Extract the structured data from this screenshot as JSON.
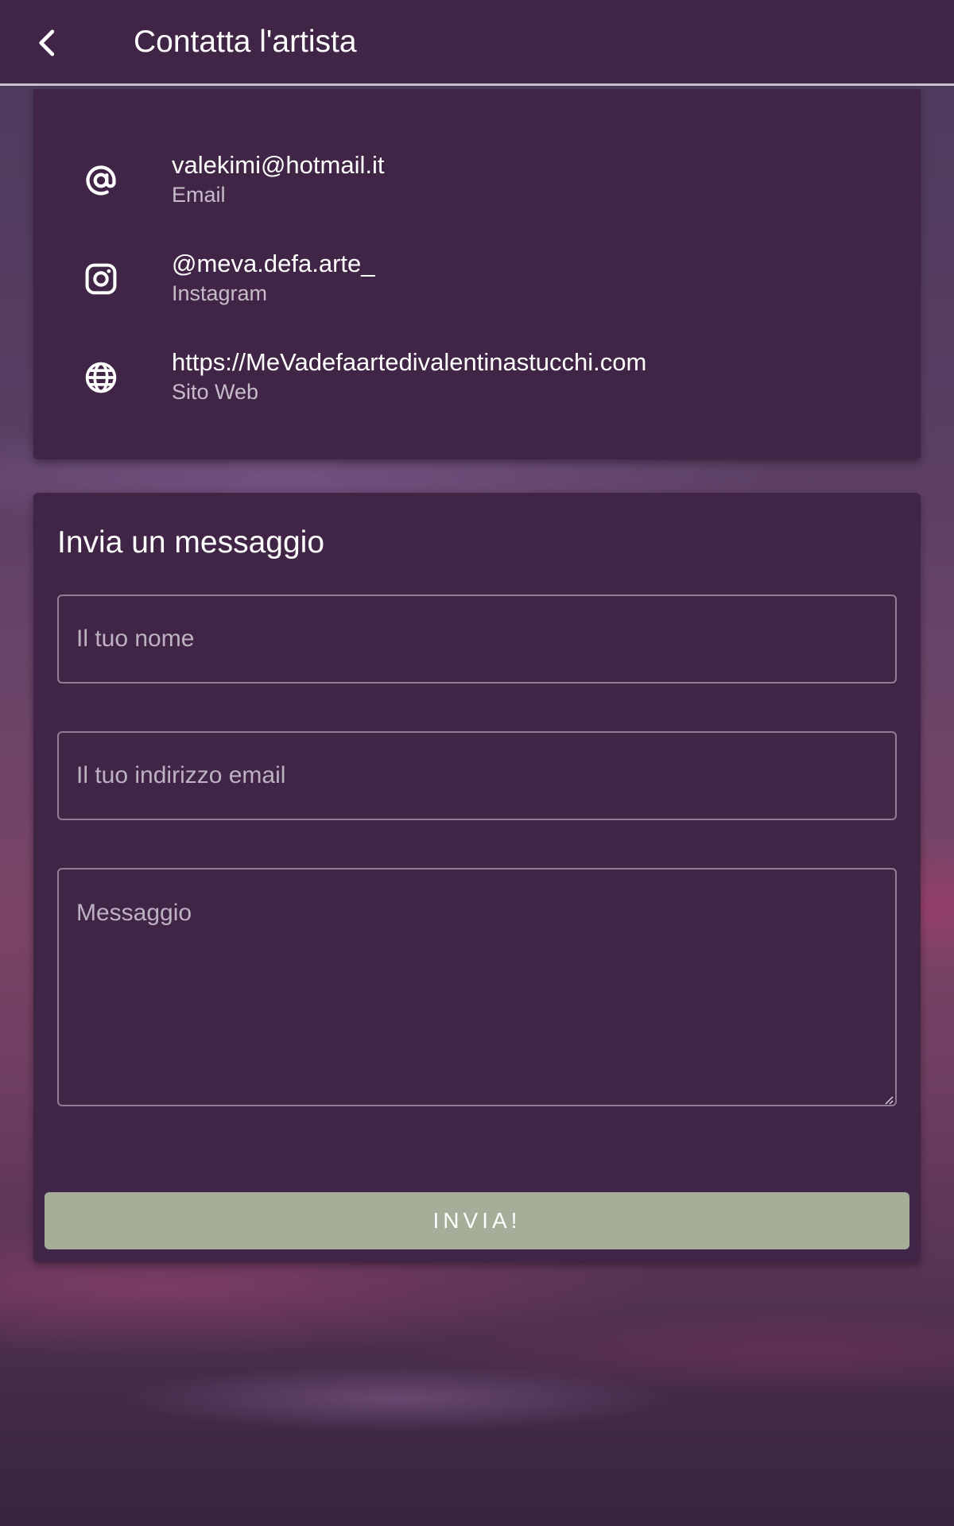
{
  "appbar": {
    "title": "Contatta l'artista",
    "back_icon": "chevron-left-icon"
  },
  "contacts": {
    "items": [
      {
        "icon": "at-sign-icon",
        "value": "valekimi@hotmail.it",
        "label": "Email"
      },
      {
        "icon": "instagram-icon",
        "value": "@meva.defa.arte_",
        "label": "Instagram"
      },
      {
        "icon": "globe-icon",
        "value": "https://MeVadefaartedivalentinastucchi.com",
        "label": "Sito Web"
      }
    ]
  },
  "form": {
    "title": "Invia un messaggio",
    "name_placeholder": "Il tuo nome",
    "name_value": "",
    "email_placeholder": "Il tuo indirizzo email",
    "email_value": "",
    "message_placeholder": "Messaggio",
    "message_value": "",
    "submit_label": "INVIA!"
  },
  "colors": {
    "surface": "#412546",
    "button": "#a5ae99",
    "secondary_text": "#c6bcc9",
    "field_border": "#8e7d93"
  }
}
